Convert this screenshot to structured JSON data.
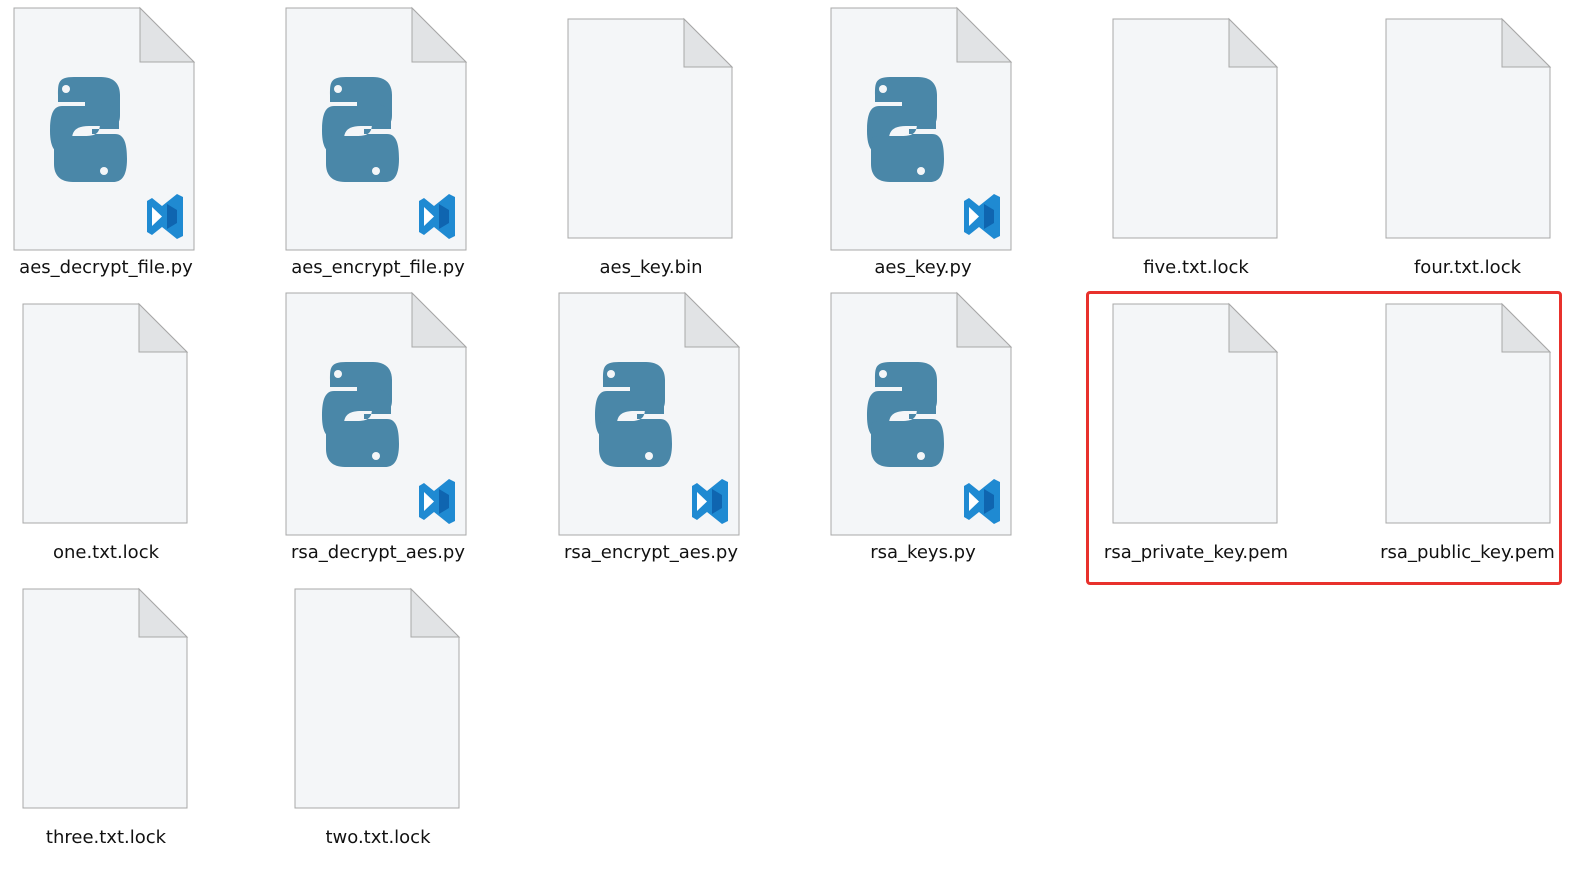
{
  "folder_view": {
    "items": [
      {
        "name": "aes_decrypt_file.py",
        "icon": "python-file-icon"
      },
      {
        "name": "aes_encrypt_file.py",
        "icon": "python-file-icon"
      },
      {
        "name": "aes_key.bin",
        "icon": "blank-file-icon"
      },
      {
        "name": "aes_key.py",
        "icon": "python-file-icon"
      },
      {
        "name": "five.txt.lock",
        "icon": "blank-file-icon"
      },
      {
        "name": "four.txt.lock",
        "icon": "blank-file-icon"
      },
      {
        "name": "one.txt.lock",
        "icon": "blank-file-icon"
      },
      {
        "name": "rsa_decrypt_aes.py",
        "icon": "python-file-icon"
      },
      {
        "name": "rsa_encrypt_aes.py",
        "icon": "python-file-icon"
      },
      {
        "name": "rsa_keys.py",
        "icon": "python-file-icon"
      },
      {
        "name": "rsa_private_key.pem",
        "icon": "blank-file-icon"
      },
      {
        "name": "rsa_public_key.pem",
        "icon": "blank-file-icon"
      },
      {
        "name": "three.txt.lock",
        "icon": "blank-file-icon"
      },
      {
        "name": "two.txt.lock",
        "icon": "blank-file-icon"
      }
    ],
    "highlight_color": "#e8312c",
    "python_logo_color": "#4a87a8",
    "vscode_blue": "#1f8ad2"
  }
}
